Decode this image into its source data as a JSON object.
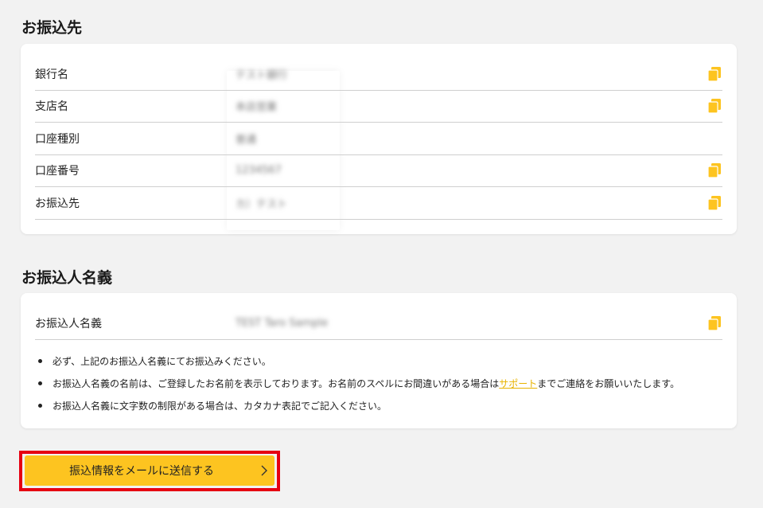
{
  "accent_color": "#fdc420",
  "highlight_color": "#e60012",
  "transfer_destination": {
    "title": "お振込先",
    "rows": [
      {
        "label": "銀行名",
        "value": "テスト銀行",
        "copyable": true
      },
      {
        "label": "支店名",
        "value": "本店営業",
        "copyable": true
      },
      {
        "label": "口座種別",
        "value": "普通",
        "copyable": false
      },
      {
        "label": "口座番号",
        "value": "1234567",
        "copyable": true
      },
      {
        "label": "お振込先",
        "value": "カ）テスト",
        "copyable": true
      }
    ]
  },
  "remitter_name": {
    "title": "お振込人名義",
    "row": {
      "label": "お振込人名義",
      "value": "TEST Taro Sample",
      "copyable": true
    },
    "notes": [
      {
        "text": "必ず、上記のお振込人名義にてお振込みください。"
      },
      {
        "text_before": "お振込人名義の名前は、ご登録したお名前を表示しております。お名前のスペルにお間違いがある場合は",
        "link": "サポート",
        "text_after": "までご連絡をお願いいたします。"
      },
      {
        "text": "お振込人名義に文字数の制限がある場合は、カタカナ表記でご記入ください。"
      }
    ]
  },
  "send_button": {
    "label": "振込情報をメールに送信する",
    "icon": "chevron-right-icon"
  },
  "icons": {
    "copy": "copy-icon"
  }
}
